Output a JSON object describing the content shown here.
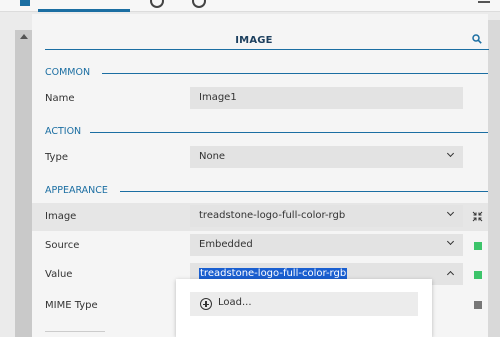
{
  "panel": {
    "title": "IMAGE"
  },
  "sections": {
    "common": "COMMON",
    "action": "ACTION",
    "appearance": "APPEARANCE"
  },
  "rows": {
    "name": {
      "label": "Name",
      "value": "Image1"
    },
    "type": {
      "label": "Type",
      "value": "None"
    },
    "image": {
      "label": "Image",
      "value": "treadstone-logo-full-color-rgb"
    },
    "source": {
      "label": "Source",
      "value": "Embedded"
    },
    "value": {
      "label": "Value",
      "value": "treadstone-logo-full-color-rgb"
    },
    "mime_type": {
      "label": "MIME Type",
      "value": "<"
    }
  },
  "dropdown": {
    "items": [
      {
        "label": "Load..."
      }
    ]
  },
  "colors": {
    "accent": "#1b6ea2",
    "selection": "#1a5fd0",
    "status_green": "#3cc46a",
    "status_gray": "#777777"
  },
  "icons": {
    "search": "search-icon",
    "collapse": "collapse-arrows-icon",
    "chevron_down": "chevron-down-icon",
    "chevron_up": "chevron-up-icon",
    "add": "plus-circle-icon"
  }
}
